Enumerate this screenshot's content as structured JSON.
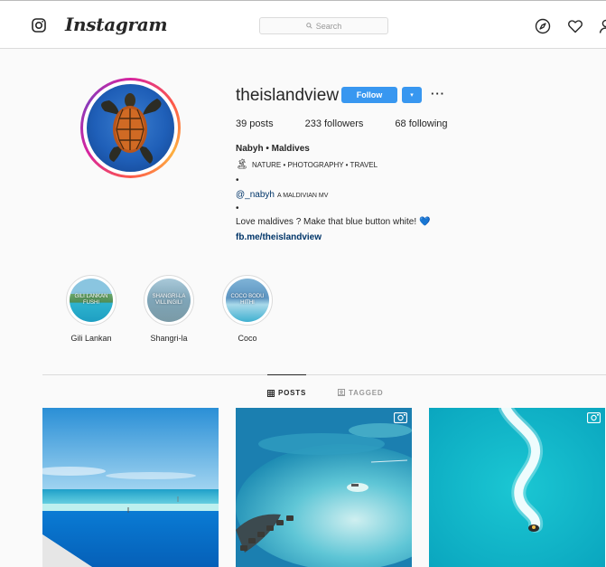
{
  "header": {
    "wordmark": "Instagram",
    "search_placeholder": "Search",
    "icons": [
      "instagram-icon",
      "compass-icon",
      "heart-icon",
      "user-icon"
    ]
  },
  "profile": {
    "username": "theislandview",
    "follow_label": "Follow",
    "dropdown_label": "▾",
    "more_label": "···",
    "stats": {
      "posts": "39 posts",
      "followers": "233 followers",
      "following": "68 following"
    },
    "bio": {
      "name": "Nabyh • Maldives",
      "line2_emoji": "🏝",
      "line2": "NATURE • PHOTOGRAPHY • TRAVEL",
      "dot1": "•",
      "mention": "@_nabyh",
      "mention_note": "A MALDIVIAN MV",
      "dot2": "•",
      "line6": "Love maldives ? Make that blue button white!",
      "line6_emoji": "💙",
      "link": "fb.me/theislandview"
    }
  },
  "highlights": [
    {
      "label": "Gili Lankan",
      "overlay": "GILI LANKAN FUSHI"
    },
    {
      "label": "Shangri-la",
      "overlay": "SHANGRI-LA VILLINGILI"
    },
    {
      "label": "Coco",
      "overlay": "COCO BODU HITHI"
    }
  ],
  "tabs": [
    {
      "label": "POSTS",
      "active": true
    },
    {
      "label": "TAGGED",
      "active": false
    }
  ],
  "colors": {
    "accent": "#3897f0",
    "link": "#003569",
    "border": "#dbdbdb",
    "background": "#fafafa"
  }
}
